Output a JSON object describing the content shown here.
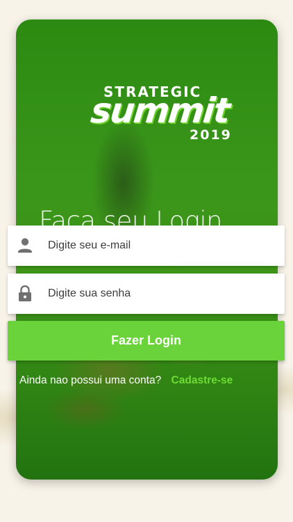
{
  "logo": {
    "top_text": "STRATEGIC",
    "main_text": "summit",
    "year": "2019"
  },
  "title": "Faça seu Login",
  "email": {
    "placeholder": "Digite seu e-mail",
    "value": "",
    "icon": "person-icon"
  },
  "password": {
    "placeholder": "Digite sua senha",
    "value": "",
    "icon": "lock-icon"
  },
  "login_button": "Fazer Login",
  "signup": {
    "prompt": "Ainda nao possui uma conta?",
    "link": "Cadastre-se"
  },
  "colors": {
    "card_green": "#3a961a",
    "button_green": "#6ad23a",
    "link_green": "#6ddc33"
  }
}
